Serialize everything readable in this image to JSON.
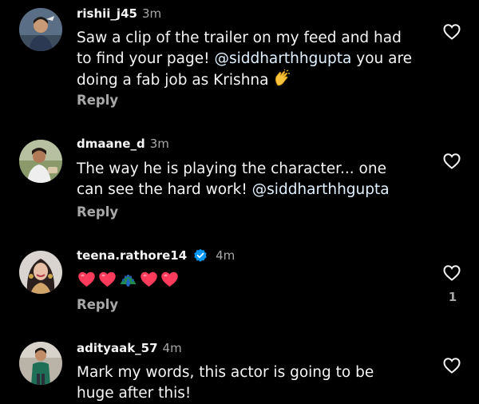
{
  "comments": [
    {
      "username": "rishii_j45",
      "time": "3m",
      "lines": [
        "Saw a clip of the trailer on my feed and had",
        "to find your page! ",
        "doing a fab job as Krishna"
      ],
      "mention": "@siddharthhgupta",
      "line2_tail": " you are",
      "reply_label": "Reply",
      "emoji_icon": "clapping-hands-icon"
    },
    {
      "username": "dmaane_d",
      "time": "3m",
      "lines": [
        "The way he is playing the character... one",
        "can see the hard work! "
      ],
      "mention": "@siddharthhgupta",
      "reply_label": "Reply"
    },
    {
      "username": "teena.rathore14",
      "time": "4m",
      "verified": true,
      "emojis": [
        "red-heart-icon",
        "red-heart-icon",
        "peacock-icon",
        "red-heart-icon",
        "red-heart-icon"
      ],
      "reply_label": "Reply",
      "like_count": "1"
    },
    {
      "username": "adityaak_57",
      "time": "4m",
      "lines": [
        "Mark my words, this actor is going to be",
        "huge after this!"
      ]
    }
  ],
  "colors": {
    "background": "#000000",
    "primary_text": "#f5f5f5",
    "secondary_text": "#a8a8a8",
    "mention": "#e0f1ff",
    "verified_badge": "#0095f6",
    "heart": "#ff3b5c"
  }
}
